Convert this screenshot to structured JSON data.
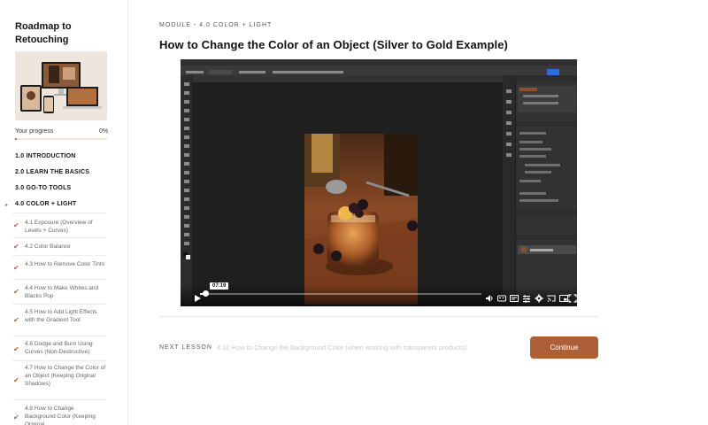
{
  "sidebar": {
    "course_title": "Roadmap to Retouching",
    "progress_label": "Your progress",
    "progress_value": "0%",
    "progress_fraction": 0.02,
    "sections": [
      {
        "label": "1.0 INTRODUCTION"
      },
      {
        "label": "2.0 LEARN THE BASICS"
      },
      {
        "label": "3.0 GO-TO TOOLS"
      },
      {
        "label": "4.0 COLOR + LIGHT"
      }
    ],
    "lessons": [
      {
        "label": "4.1 Exposure (Overview of Levels + Curves)"
      },
      {
        "label": "4.2 Color Balance"
      },
      {
        "label": "4.3 How to Remove Color Tints"
      },
      {
        "label": "4.4 How to Make Whites and Blacks Pop"
      },
      {
        "label": "4.5 How to Add Light Effects with the Gradient Tool"
      },
      {
        "label": "4.6 Dodge and Burn Using Curves (Non-Destructive)"
      },
      {
        "label": "4.7 How to Change the Color of an Object (Keeping Original Shadows)"
      },
      {
        "label": "4.8 How to Change Background Color (Keeping Original"
      }
    ]
  },
  "main": {
    "module_label": "MODULE - 4.0 COLOR + LIGHT",
    "lesson_title": "How to Change the Color of an Object (Silver to Gold Example)",
    "video": {
      "time_tooltip": "07:19",
      "progress_fraction": 0.02
    },
    "next_lesson_label": "NEXT LESSON",
    "next_lesson_title": "4.10 How to Change the Background Color (when working with transparent products)",
    "continue_label": "Continue"
  },
  "colors": {
    "accent": "#ad5f37",
    "check": "#a9653b"
  }
}
